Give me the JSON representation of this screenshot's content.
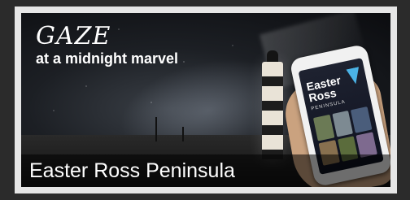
{
  "banner": {
    "headline_line1": "GAZE",
    "headline_line2": "at a midnight marvel",
    "footer_caption": "Easter Ross Peninsula"
  },
  "phone_app": {
    "title_line1": "Easter",
    "title_line2": "Ross",
    "subtitle": "PENINSULA",
    "tile_count_visible": 6
  },
  "colors": {
    "card_border": "#e6e6e6",
    "app_accent": "#4bb3e6"
  }
}
